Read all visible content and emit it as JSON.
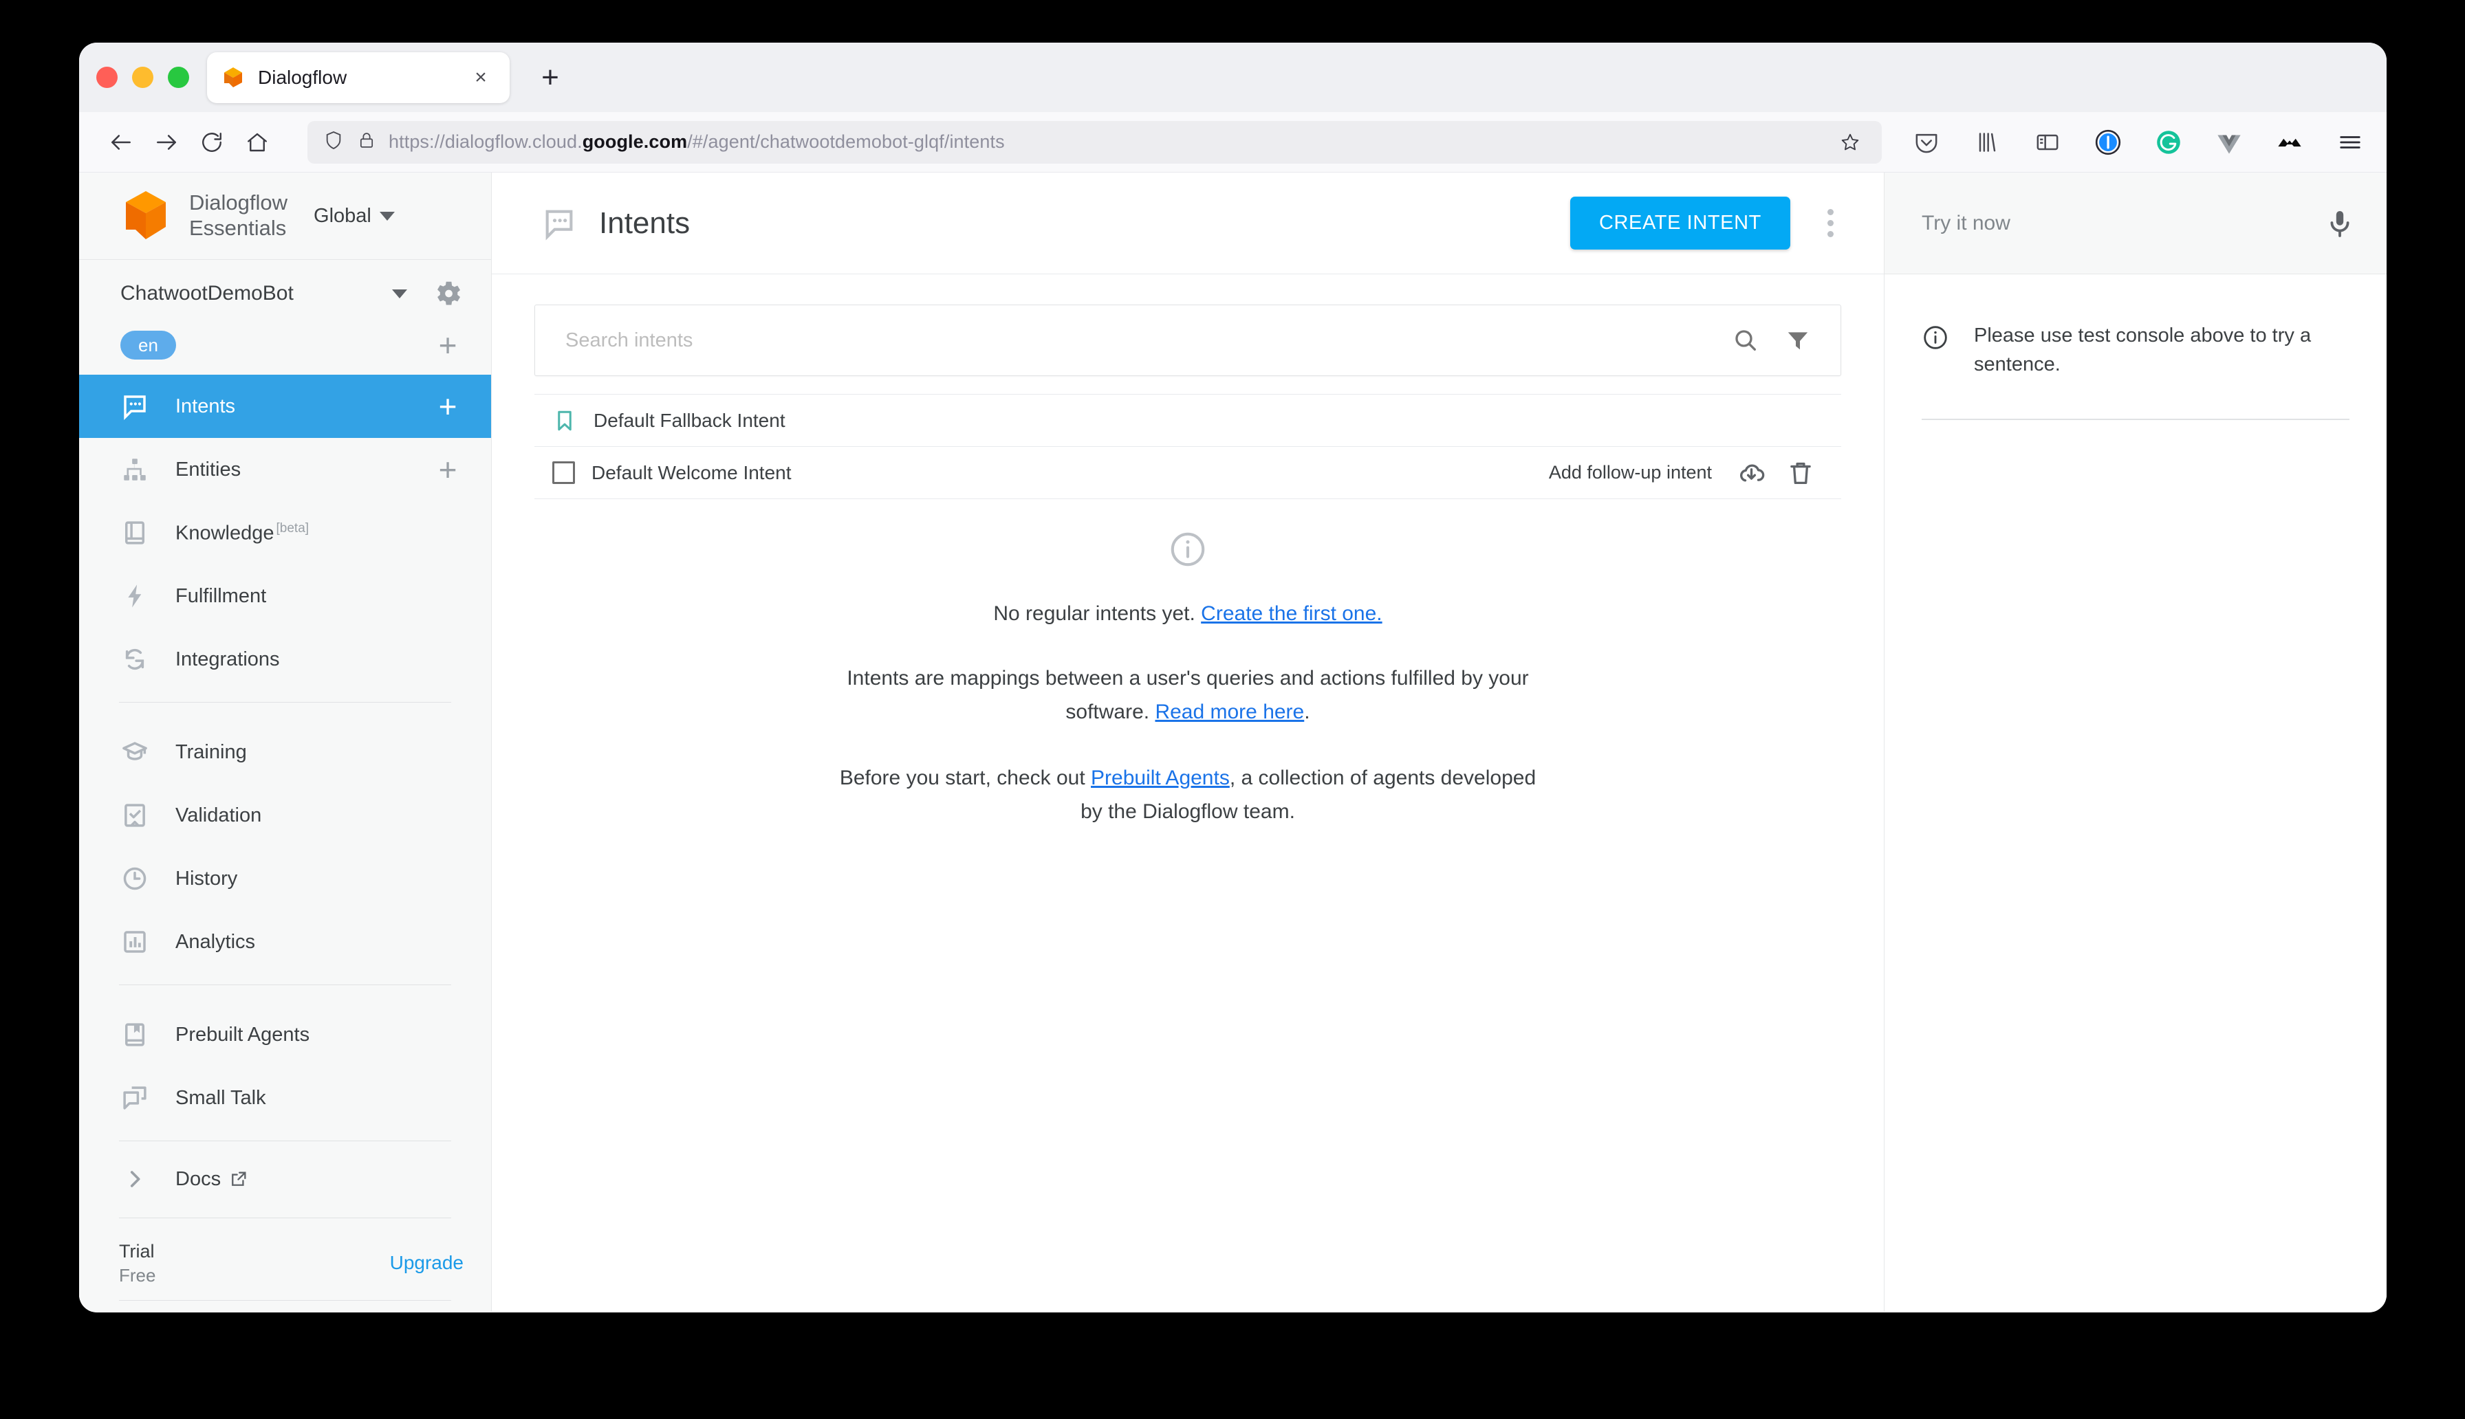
{
  "browser": {
    "tab": {
      "title": "Dialogflow",
      "favicon": "dialogflow-favicon",
      "close": "×"
    },
    "new_tab": "+",
    "nav": {
      "back": "back-arrow",
      "forward": "forward-arrow",
      "reload": "reload",
      "home": "home"
    },
    "url": {
      "prefix": "https://dialogflow.cloud.",
      "host": "google.com",
      "suffix": "/#/agent/chatwootdemobot-glqf/intents",
      "full": "https://dialogflow.cloud.google.com/#/agent/chatwootdemobot-glqf/intents"
    },
    "extensions": [
      "pocket-icon",
      "library-icon",
      "sidebar-icon",
      "1password-icon",
      "grammarly-icon",
      "vue-devtools-icon",
      "metamask-icon",
      "hamburger-menu-icon"
    ]
  },
  "sidebar": {
    "brand": {
      "name": "Dialogflow\nEssentials",
      "region": "Global"
    },
    "agent": {
      "name": "ChatwootDemoBot",
      "language": "en"
    },
    "nav_primary": [
      {
        "label": "Intents",
        "icon": "chat-bubble-icon",
        "active": true,
        "has_plus": true
      },
      {
        "label": "Entities",
        "icon": "hierarchy-icon",
        "active": false,
        "has_plus": true
      },
      {
        "label": "Knowledge",
        "badge": "[beta]",
        "icon": "book-icon",
        "active": false,
        "has_plus": false
      },
      {
        "label": "Fulfillment",
        "icon": "bolt-icon",
        "active": false,
        "has_plus": false
      },
      {
        "label": "Integrations",
        "icon": "sync-icon",
        "active": false,
        "has_plus": false
      }
    ],
    "nav_secondary": [
      {
        "label": "Training",
        "icon": "graduation-cap-icon"
      },
      {
        "label": "Validation",
        "icon": "checklist-icon"
      },
      {
        "label": "History",
        "icon": "clock-icon"
      },
      {
        "label": "Analytics",
        "icon": "bar-chart-icon"
      }
    ],
    "nav_tertiary": [
      {
        "label": "Prebuilt Agents",
        "icon": "bookmark-book-icon"
      },
      {
        "label": "Small Talk",
        "icon": "speech-bubbles-icon"
      }
    ],
    "docs": {
      "label": "Docs",
      "icon": "chevron-right-icon",
      "external": "external-link-icon"
    },
    "plan": {
      "title": "Trial",
      "subtitle": "Free",
      "upgrade": "Upgrade"
    }
  },
  "main": {
    "header": {
      "title": "Intents",
      "icon": "chat-bubble-icon",
      "create_button": "CREATE INTENT",
      "menu": "kebab-menu-icon"
    },
    "search": {
      "placeholder": "Search intents",
      "value": "",
      "search_icon": "search-icon",
      "filter_icon": "filter-icon"
    },
    "intents": [
      {
        "name": "Default Fallback Intent",
        "marker": "bookmark-icon",
        "actions": []
      },
      {
        "name": "Default Welcome Intent",
        "marker": "checkbox-icon",
        "action_label": "Add follow-up intent",
        "actions": [
          "cloud-download-icon",
          "trash-icon"
        ]
      }
    ],
    "empty": {
      "icon": "info-circle-icon",
      "headline_text": "No regular intents yet. ",
      "headline_link": "Create the first one.",
      "para1_a": "Intents are mappings between a user's queries and actions fulfilled by your software. ",
      "para1_link": "Read more here",
      "para1_b": ".",
      "para2_a": "Before you start, check out ",
      "para2_link": "Prebuilt Agents",
      "para2_b": ", a collection of agents developed by the Dialogflow team."
    }
  },
  "right_panel": {
    "try_placeholder": "Try it now",
    "mic_icon": "microphone-icon",
    "hint_icon": "info-circle-icon",
    "hint_text": "Please use test console above to try a sentence."
  },
  "colors": {
    "accent_blue": "#03a9f4",
    "active_nav": "#33a2e5",
    "link_blue": "#1a73e8",
    "upgrade_blue": "#1a9ae8",
    "bookmark_teal": "#4db6ac",
    "lang_chip": "#5eaceb"
  }
}
